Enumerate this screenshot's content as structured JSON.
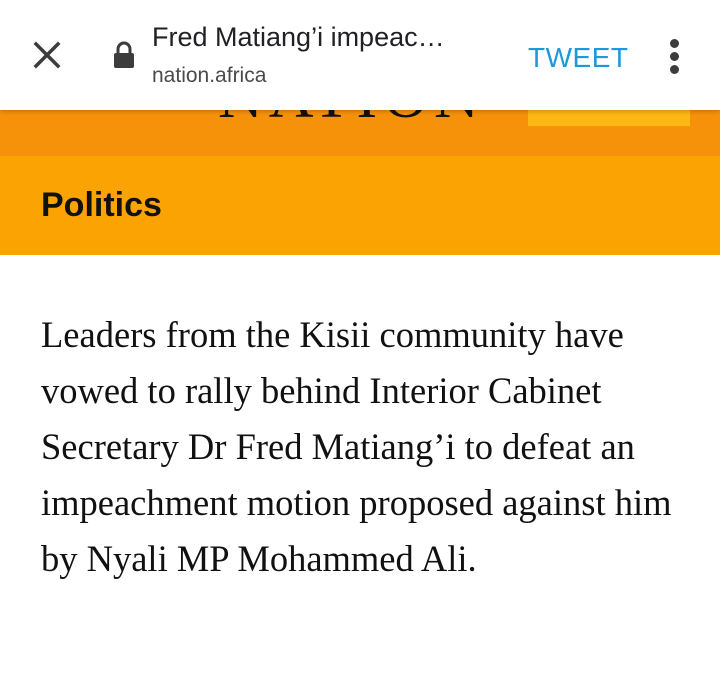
{
  "browser": {
    "tab_title": "Fred Matiang’i impeac…",
    "url": "nation.africa",
    "tweet_label": "TWEET",
    "icons": {
      "close": "close-icon",
      "lock": "lock-icon",
      "more": "more-vert-icon"
    }
  },
  "site": {
    "logo_text": "NATION",
    "colors": {
      "header_orange": "#f6920a",
      "section_orange": "#fba302",
      "logo_accent": "#fdb813",
      "tweet_blue": "#1e98d6"
    }
  },
  "section": {
    "label": "Politics"
  },
  "article": {
    "lead": "Leaders from the Kisii community have vowed to rally behind Interior Cabinet Secretary Dr Fred Matiang’i to defeat an impeachment motion proposed against him by Nyali MP Mohammed Ali."
  }
}
